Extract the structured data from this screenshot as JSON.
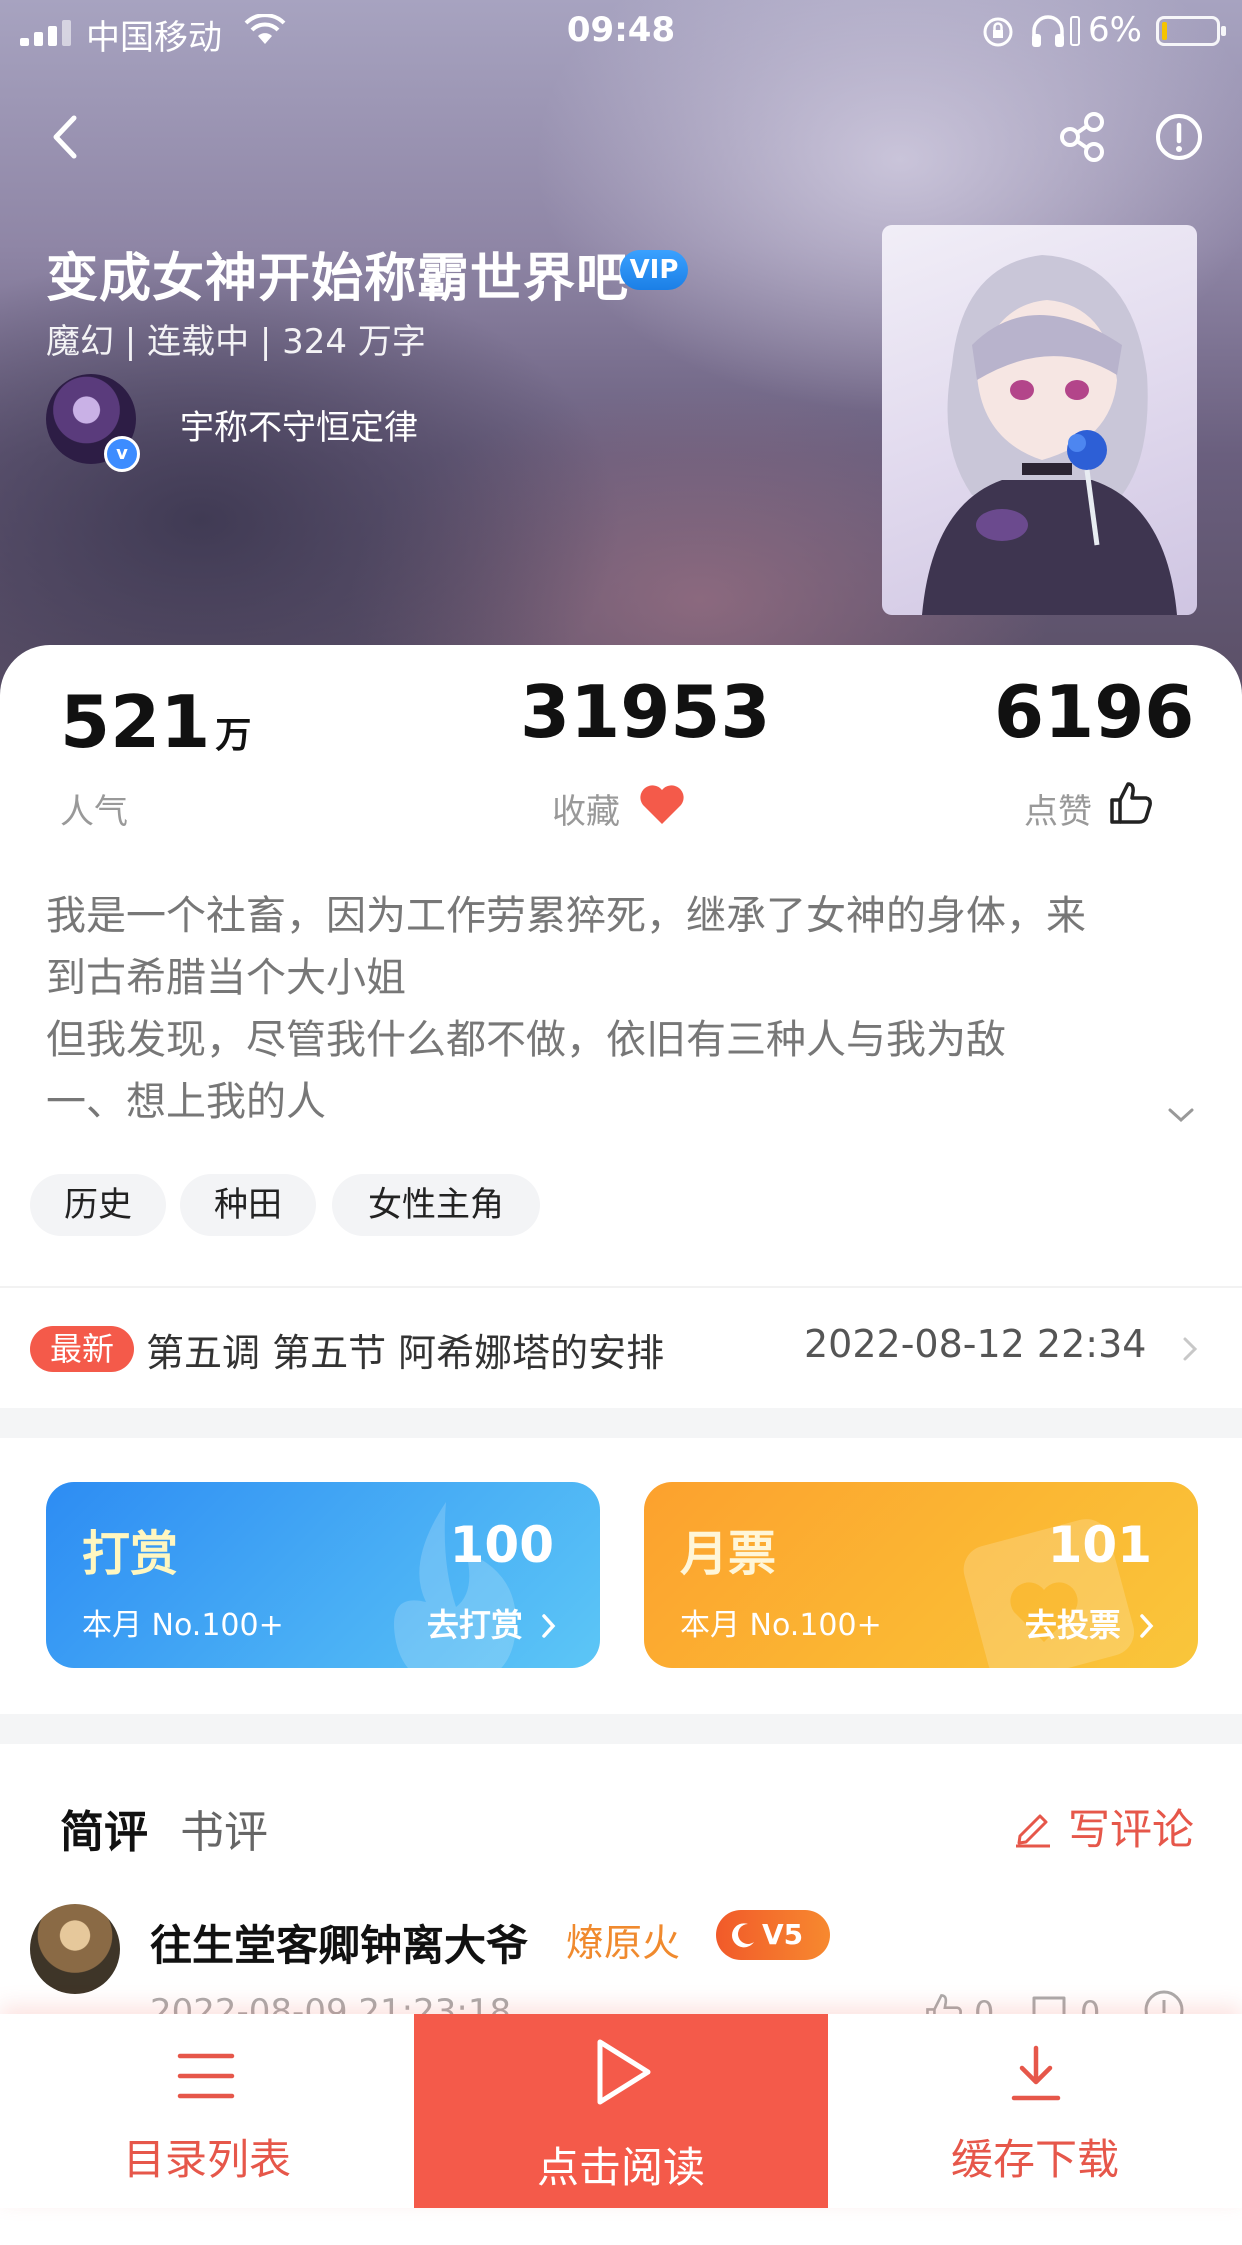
{
  "status_bar": {
    "carrier": "中国移动",
    "time": "09:48",
    "battery_percent": "6%"
  },
  "book": {
    "title": "变成女神开始称霸世界吧",
    "vip_badge": "VIP",
    "meta": "魔幻 | 连载中 | 324 万字",
    "author": "宇称不守恒定律",
    "verified_mark": "v"
  },
  "stats": {
    "popularity": {
      "value": "521",
      "unit": "万",
      "label": "人气"
    },
    "favorites": {
      "value": "31953",
      "label": "收藏"
    },
    "likes": {
      "value": "6196",
      "label": "点赞"
    }
  },
  "description": {
    "lines": [
      "我是一个社畜，因为工作劳累猝死，继承了女神的身体，来",
      "到古希腊当个大小姐",
      "但我发现，尽管我什么都不做，依旧有三种人与我为敌",
      "一、想上我的人"
    ]
  },
  "tags": [
    "历史",
    "种田",
    "女性主角"
  ],
  "latest": {
    "badge": "最新",
    "chapter": "第五调 第五节 阿希娜塔的安排",
    "time": "2022-08-12 22:34"
  },
  "promos": {
    "reward": {
      "title": "打赏",
      "count": "100",
      "rank": "本月 No.100+",
      "action": "去打赏"
    },
    "monthly_ticket": {
      "title": "月票",
      "count": "101",
      "rank": "本月 No.100+",
      "action": "去投票"
    }
  },
  "reviews": {
    "tabs": [
      "简评",
      "书评"
    ],
    "write_label": "写评论",
    "first": {
      "user": "往生堂客卿钟离大爷",
      "rank": "燎原火",
      "level": "V5",
      "time": "2022-08-09 21:23:18",
      "likes": "0",
      "comments": "0"
    }
  },
  "bottom_bar": {
    "catalog": "目录列表",
    "read": "点击阅读",
    "download": "缓存下载"
  },
  "colors": {
    "accent": "#f45a4a",
    "vip_blue": "#1b7fe6",
    "reward_blue": "#2d8cf3",
    "ticket_orange": "#fca12e"
  }
}
